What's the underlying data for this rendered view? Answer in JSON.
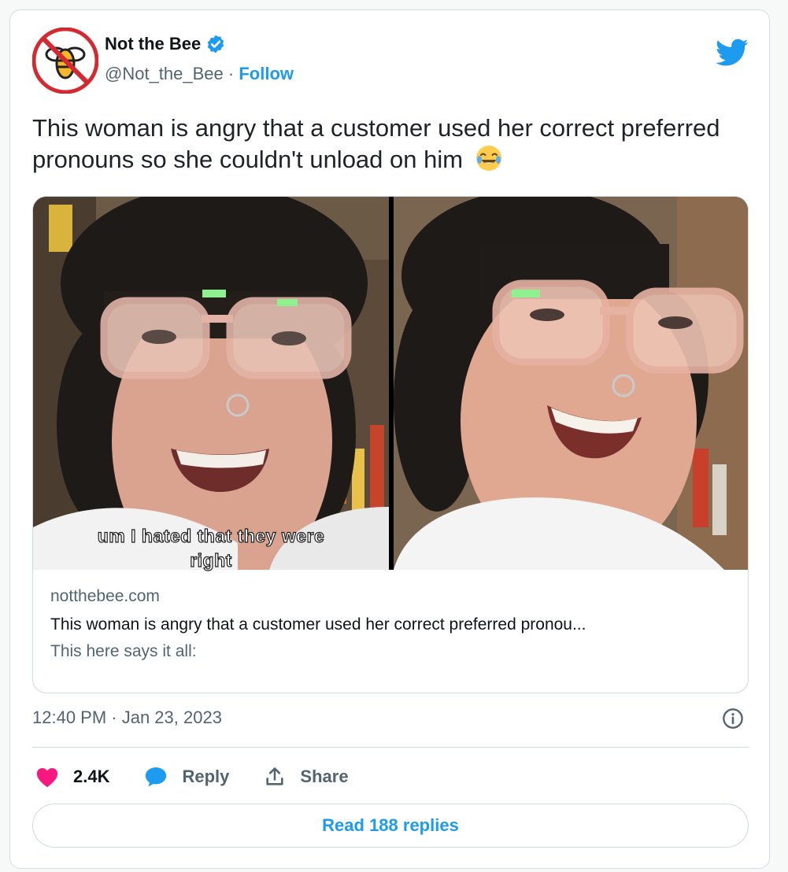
{
  "tweet": {
    "author_name": "Not the Bee",
    "handle": "@Not_the_Bee",
    "separator": " · ",
    "follow_label": "Follow",
    "text": "This woman is angry that a customer used her correct preferred pronouns so she couldn't unload on him",
    "emoji": "face-with-tears-of-joy",
    "timestamp": "12:40 PM · Jan 23, 2023"
  },
  "media": {
    "caption_line1": "um I hated that they were",
    "caption_line2": "right"
  },
  "link_card": {
    "domain": "notthebee.com",
    "title": "This woman is angry that a customer used her correct preferred pronou...",
    "description": "This here says it all:"
  },
  "actions": {
    "like_count": "2.4K",
    "reply_label": "Reply",
    "share_label": "Share"
  },
  "read_replies_label": "Read 188 replies",
  "icons": {
    "verified": "verified-badge-icon",
    "twitter": "twitter-bird-icon",
    "info": "info-icon",
    "like": "heart-icon",
    "reply": "speech-bubble-icon",
    "share": "share-upload-icon"
  },
  "colors": {
    "accent": "#1d9bf0",
    "like": "#f91880",
    "text": "#0f1419",
    "muted": "#536471"
  }
}
